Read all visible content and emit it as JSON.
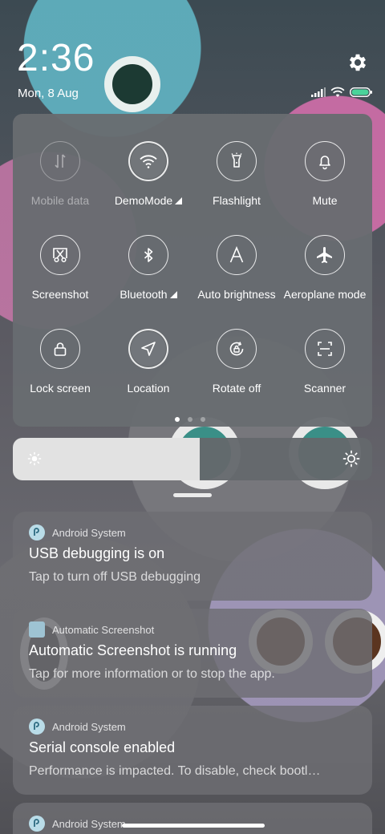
{
  "status_bar": {
    "time": "2:36",
    "date": "Mon, 8 Aug"
  },
  "quick_settings": {
    "tiles": [
      {
        "label": "Mobile data",
        "icon": "mobile-data-icon",
        "state": "disabled"
      },
      {
        "label": "DemoMode",
        "icon": "wifi-icon",
        "state": "active",
        "has_signal_triangle": true
      },
      {
        "label": "Flashlight",
        "icon": "flashlight-icon",
        "state": "off"
      },
      {
        "label": "Mute",
        "icon": "bell-icon",
        "state": "off"
      },
      {
        "label": "Screenshot",
        "icon": "screenshot-icon",
        "state": "off"
      },
      {
        "label": "Bluetooth",
        "icon": "bluetooth-icon",
        "state": "off",
        "has_signal_triangle": true
      },
      {
        "label": "Auto brightness",
        "icon": "auto-brightness-icon",
        "state": "off"
      },
      {
        "label": "Aeroplane mode",
        "icon": "airplane-icon",
        "state": "off"
      },
      {
        "label": "Lock screen",
        "icon": "lock-icon",
        "state": "off"
      },
      {
        "label": "Location",
        "icon": "location-icon",
        "state": "active"
      },
      {
        "label": "Rotate off",
        "icon": "rotate-lock-icon",
        "state": "off"
      },
      {
        "label": "Scanner",
        "icon": "scanner-icon",
        "state": "off"
      }
    ],
    "pages": 3,
    "current_page": 1
  },
  "brightness": {
    "level": 0.52
  },
  "notifications": [
    {
      "app": "Android System",
      "app_icon": "android-system-icon",
      "title": "USB debugging is on",
      "body": "Tap to turn off USB debugging"
    },
    {
      "app": "Automatic Screenshot",
      "app_icon": "automatic-screenshot-icon",
      "title": "Automatic Screenshot is running",
      "body": "Tap for more information or to stop the app."
    },
    {
      "app": "Android System",
      "app_icon": "android-system-icon",
      "title": "Serial console enabled",
      "body": "Performance is impacted. To disable, check bootl…"
    },
    {
      "app": "Android System",
      "app_icon": "android-system-icon",
      "title": "",
      "body": ""
    }
  ]
}
